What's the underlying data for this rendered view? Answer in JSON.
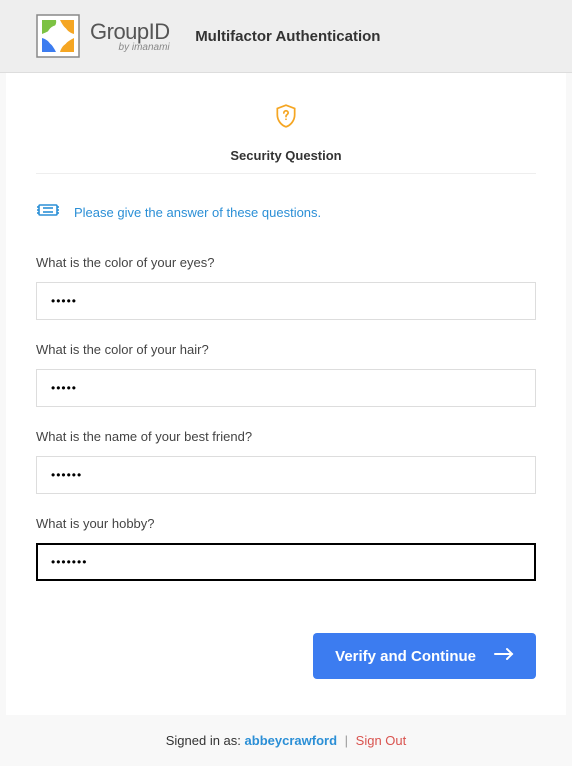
{
  "header": {
    "brand": "GroupID",
    "brand_sub": "by imanami",
    "title": "Multifactor Authentication"
  },
  "section": {
    "title": "Security Question",
    "hint": "Please give the answer of these questions."
  },
  "questions": [
    {
      "label": "What is the color of your eyes?",
      "value": "•••••",
      "focused": false
    },
    {
      "label": "What is the color of your hair?",
      "value": "•••••",
      "focused": false
    },
    {
      "label": "What is the name of your best friend?",
      "value": "••••••",
      "focused": false
    },
    {
      "label": "What is your hobby?",
      "value": "•••••••",
      "focused": true
    }
  ],
  "actions": {
    "submit": "Verify and Continue"
  },
  "footer": {
    "signed_in_as_label": "Signed in as:",
    "user": "abbeycrawford",
    "separator": "|",
    "sign_out": "Sign Out"
  },
  "icons": {
    "shield": "shield-question-icon",
    "hint": "ticket-icon",
    "arrow": "arrow-right-icon",
    "logo": "groupid-logo-icon"
  }
}
